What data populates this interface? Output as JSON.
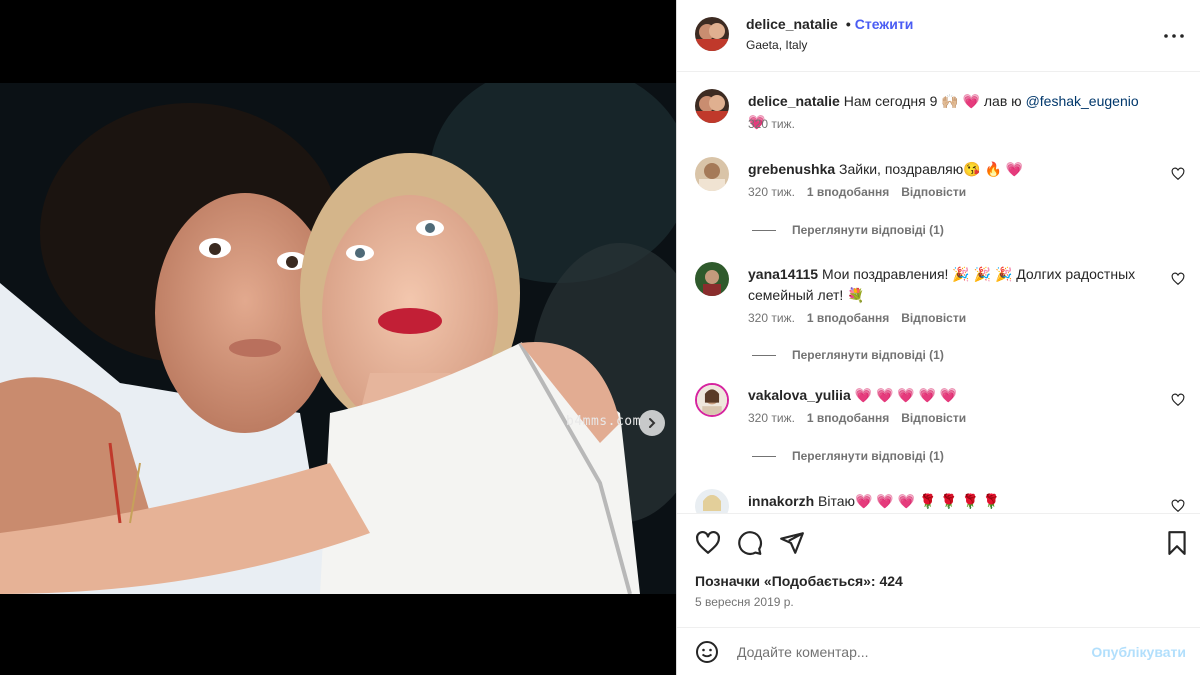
{
  "post": {
    "username": "delice_natalie",
    "follow_label": "Стежити",
    "location": "Gaeta, Italy",
    "more_icon": "more-horizontal-icon",
    "watermark": "b4mms.com",
    "carousel": {
      "count": 2,
      "active_index": 0
    }
  },
  "caption": {
    "username": "delice_natalie",
    "text_before": "Нам сегодня 9 🙌🏼 💗 лав ю ",
    "mention": "@feshak_eugenio",
    "text_after": " 💗",
    "time": "320 тиж."
  },
  "comments": [
    {
      "username": "grebenushka",
      "text": "Зайки, поздравляю😘 🔥 💗",
      "time": "320 тиж.",
      "likes_label": "1 вподобання",
      "reply_label": "Відповісти",
      "view_replies_label": "Переглянути відповіді (1)"
    },
    {
      "username": "yana14115",
      "text": "Мои поздравления! 🎉 🎉 🎉 Долгих радостных семейный лет! 💐",
      "time": "320 тиж.",
      "likes_label": "1 вподобання",
      "reply_label": "Відповісти",
      "view_replies_label": "Переглянути відповіді (1)"
    },
    {
      "username": "vakalova_yuliia",
      "text": "💗 💗 💗 💗 💗",
      "time": "320 тиж.",
      "likes_label": "1 вподобання",
      "reply_label": "Відповісти",
      "view_replies_label": "Переглянути відповіді (1)"
    },
    {
      "username": "innakorzh",
      "text": "Вітаю💗 💗 💗 🌹 🌹 🌹 🌹"
    }
  ],
  "actions": {
    "icons": [
      "heart-icon",
      "comment-icon",
      "share-icon",
      "bookmark-icon"
    ],
    "likes_text": "Позначки «Подобається»: 424",
    "date": "5 вересня 2019 р."
  },
  "comment_bar": {
    "placeholder": "Додайте коментар...",
    "publish_label": "Опублікувати"
  },
  "colors": {
    "accent": "#4a5cf3",
    "publish_disabled": "#b2dffc",
    "secondary_text": "#737373",
    "heart": "#ed4b79"
  }
}
